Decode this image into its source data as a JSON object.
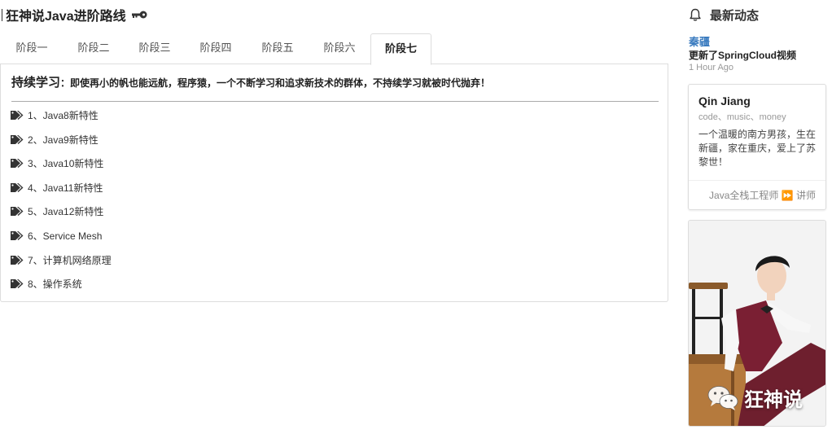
{
  "header": {
    "title": "狂神说Java进阶路线",
    "key_icon": "key-icon"
  },
  "tabs": [
    {
      "label": "阶段一",
      "active": false
    },
    {
      "label": "阶段二",
      "active": false
    },
    {
      "label": "阶段三",
      "active": false
    },
    {
      "label": "阶段四",
      "active": false
    },
    {
      "label": "阶段五",
      "active": false
    },
    {
      "label": "阶段六",
      "active": false
    },
    {
      "label": "阶段七",
      "active": true
    }
  ],
  "panel": {
    "title": "持续学习",
    "description": "：即使再小的帆也能远航，程序猿，一个不断学习和追求新技术的群体，不持续学习就被时代抛弃！",
    "items": [
      {
        "label": "1、Java8新特性"
      },
      {
        "label": "2、Java9新特性"
      },
      {
        "label": "3、Java10新特性"
      },
      {
        "label": "4、Java11新特性"
      },
      {
        "label": "5、Java12新特性"
      },
      {
        "label": "6、Service Mesh"
      },
      {
        "label": "7、计算机网络原理"
      },
      {
        "label": "8、操作系统"
      }
    ]
  },
  "sidebar": {
    "news_title": "最新动态",
    "news_user": "秦疆",
    "news_text": "更新了SpringCloud视频",
    "news_time": "1 Hour Ago",
    "card": {
      "name": "Qin Jiang",
      "tags": "code、music、money",
      "bio": "一个温暖的南方男孩，生在新疆，家在重庆，爱上了苏黎世！",
      "footer": "Java全栈工程师 ⏩ 讲师"
    },
    "photo_watermark": "狂神说"
  },
  "colors": {
    "link": "#3a7bbf",
    "border": "#dddddd",
    "muted": "#999999"
  }
}
